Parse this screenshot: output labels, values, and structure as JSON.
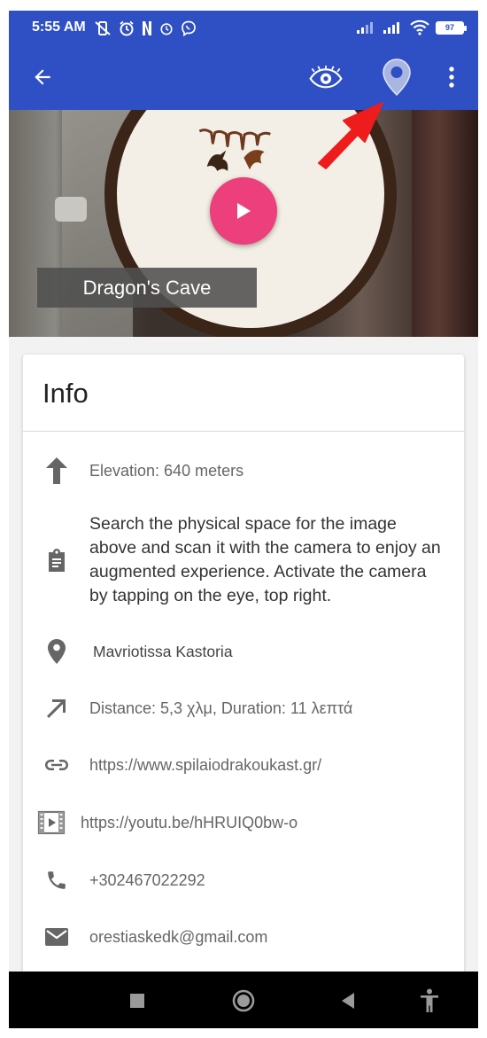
{
  "status_bar": {
    "time": "5:55 AM",
    "battery": "97",
    "left_icons": [
      "muted-vibrate-icon",
      "alarm-icon",
      "netflix-icon",
      "alarm-icon",
      "viber-icon"
    ],
    "right_icons": [
      "signal-icon",
      "signal-icon",
      "wifi-icon",
      "battery-icon"
    ]
  },
  "app_bar": {
    "back_icon": "arrow-back-icon",
    "actions": [
      "eye-icon",
      "location-pin-icon",
      "more-vert-icon"
    ],
    "color": "#2f4fc4"
  },
  "hero": {
    "title": "Dragon's Cave",
    "play_button_color": "#ec3f7c"
  },
  "info": {
    "title": "Info",
    "rows": [
      {
        "icon": "arrow-up-icon",
        "text": "Elevation: 640 meters"
      },
      {
        "icon": "clipboard-icon",
        "text": "Search the physical space for the image above and scan it with the camera to enjoy an augmented experience. Activate the camera by tapping on the eye, top right."
      },
      {
        "icon": "location-pin-icon",
        "text": "Mavriotissa Kastoria"
      },
      {
        "icon": "north-east-arrow-icon",
        "text": "Distance: 5,3 χλμ, Duration: 11 λεπτά"
      },
      {
        "icon": "link-icon",
        "text": "https://www.spilaiodrakoukast.gr/"
      },
      {
        "icon": "video-icon",
        "text": "https://youtu.be/hHRUIQ0bw-o"
      },
      {
        "icon": "phone-icon",
        "text": "+302467022292"
      },
      {
        "icon": "email-icon",
        "text": "orestiaskedk@gmail.com"
      }
    ]
  },
  "nav_bar": {
    "buttons": [
      "recents-icon",
      "home-icon",
      "back-icon",
      "accessibility-icon"
    ]
  }
}
